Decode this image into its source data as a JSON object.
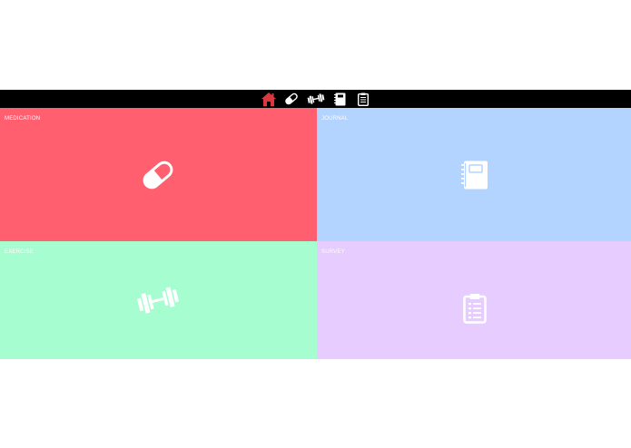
{
  "nav": {
    "home_icon": "home-icon",
    "medication_icon": "pill-icon",
    "exercise_icon": "dumbbell-icon",
    "journal_icon": "notebook-icon",
    "survey_icon": "clipboard-icon",
    "active": "home",
    "active_color": "#d9383e"
  },
  "tiles": [
    {
      "label": "MEDICATION",
      "icon": "pill-icon",
      "color": "#ff5f6f"
    },
    {
      "label": "JOURNAL",
      "icon": "notebook-icon",
      "color": "#b3d4ff"
    },
    {
      "label": "EXERCISE",
      "icon": "dumbbell-icon",
      "color": "#a6fdd0"
    },
    {
      "label": "SURVEY",
      "icon": "clipboard-icon",
      "color": "#e6ccff"
    }
  ]
}
